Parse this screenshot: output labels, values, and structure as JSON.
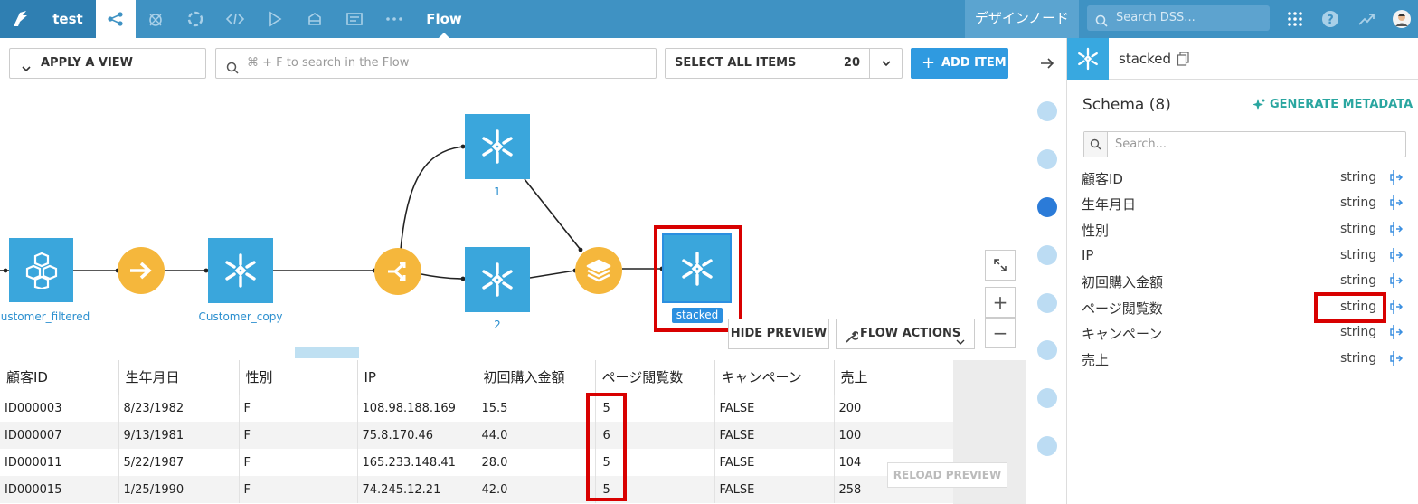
{
  "topbar": {
    "project": "test",
    "title": "Flow",
    "node": "デザインノード",
    "search_placeholder": "Search DSS..."
  },
  "toolbar": {
    "apply_view": "APPLY A VIEW",
    "search_placeholder": "⌘ + F to search in the Flow",
    "select_all": "SELECT ALL ITEMS",
    "select_count": "20",
    "add_item": "ADD ITEM"
  },
  "flow": {
    "nodes": {
      "customer_filtered": "ustomer_filtered",
      "customer_copy": "Customer_copy",
      "ds1": "1",
      "ds2": "2",
      "stacked": "stacked"
    },
    "hide_preview": "HIDE PREVIEW",
    "flow_actions": "FLOW ACTIONS"
  },
  "preview": {
    "columns": [
      "顧客ID",
      "生年月日",
      "性別",
      "IP",
      "初回購入金額",
      "ページ閲覧数",
      "キャンペーン",
      "売上"
    ],
    "rows": [
      [
        "ID000003",
        "8/23/1982",
        "F",
        "108.98.188.169",
        "15.5",
        "5",
        "FALSE",
        "200"
      ],
      [
        "ID000007",
        "9/13/1981",
        "F",
        "75.8.170.46",
        "44.0",
        "6",
        "FALSE",
        "100"
      ],
      [
        "ID000011",
        "5/22/1987",
        "F",
        "165.233.148.41",
        "28.0",
        "5",
        "FALSE",
        "104"
      ],
      [
        "ID000015",
        "1/25/1990",
        "F",
        "74.245.12.21",
        "42.0",
        "5",
        "FALSE",
        "258"
      ]
    ],
    "reload": "RELOAD PREVIEW"
  },
  "panel": {
    "title": "stacked",
    "schema_title": "Schema (8)",
    "generate": "GENERATE METADATA",
    "search_placeholder": "Search...",
    "schema": [
      {
        "name": "顧客ID",
        "type": "string"
      },
      {
        "name": "生年月日",
        "type": "string"
      },
      {
        "name": "性別",
        "type": "string"
      },
      {
        "name": "IP",
        "type": "string"
      },
      {
        "name": "初回購入金額",
        "type": "string"
      },
      {
        "name": "ページ閲覧数",
        "type": "string"
      },
      {
        "name": "キャンペーン",
        "type": "string"
      },
      {
        "name": "売上",
        "type": "string"
      }
    ]
  },
  "colors": {
    "topbar": "#3f92c3",
    "dataset": "#3aa6dc",
    "recipe": "#f5b73c",
    "highlight": "#d80000",
    "accent": "#2f9ae0"
  }
}
